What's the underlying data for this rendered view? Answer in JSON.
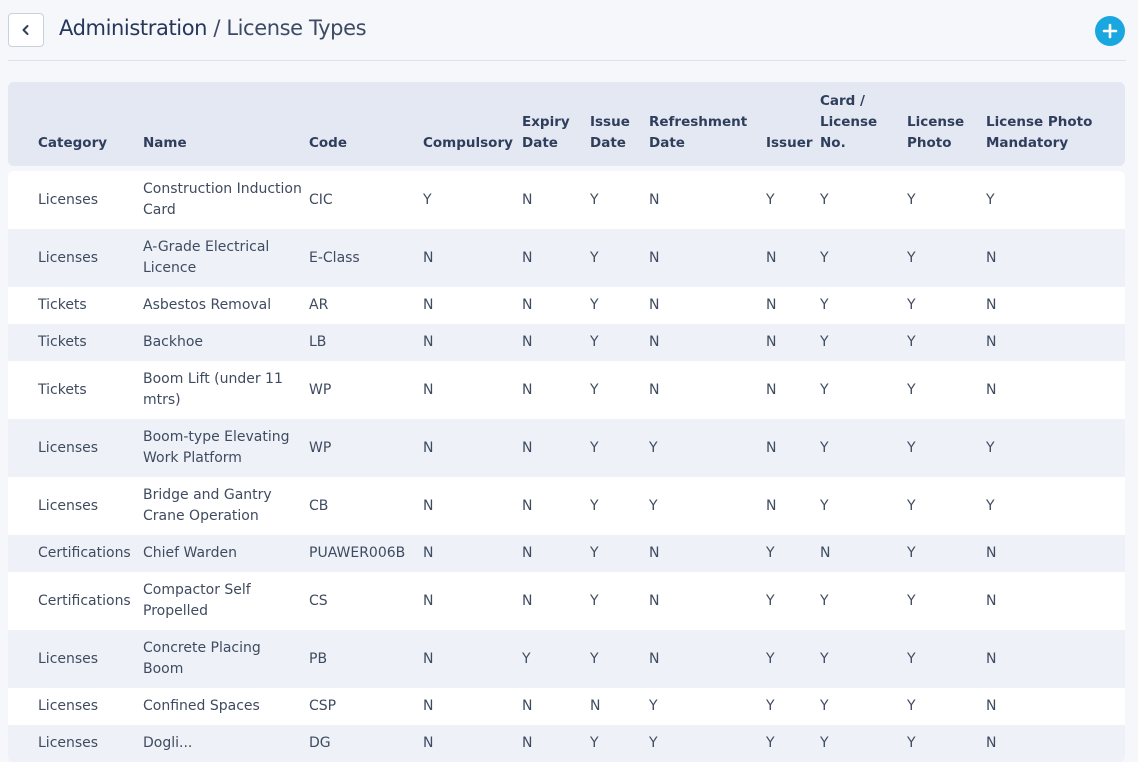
{
  "header": {
    "breadcrumb_main": "Administration",
    "breadcrumb_sep": "/",
    "breadcrumb_current": "License Types"
  },
  "icons": {
    "back": "chevron-left-icon",
    "add": "plus-circle-icon"
  },
  "colors": {
    "accent": "#1aa7e0",
    "header_bg": "#e3e8f2",
    "row_alt_bg": "#eef2f8",
    "page_bg": "#f5f7fb"
  },
  "table": {
    "columns": [
      "Category",
      "Name",
      "Code",
      "Compulsory",
      "Expiry Date",
      "Issue Date",
      "Refreshment Date",
      "Issuer",
      "Card / License No.",
      "License Photo",
      "License Photo Mandatory"
    ],
    "rows": [
      [
        "Licenses",
        "Construction Induction Card",
        "CIC",
        "Y",
        "N",
        "Y",
        "N",
        "Y",
        "Y",
        "Y",
        "Y"
      ],
      [
        "Licenses",
        "A-Grade Electrical Licence",
        "E-Class",
        "N",
        "N",
        "Y",
        "N",
        "N",
        "Y",
        "Y",
        "N"
      ],
      [
        "Tickets",
        "Asbestos Removal",
        "AR",
        "N",
        "N",
        "Y",
        "N",
        "N",
        "Y",
        "Y",
        "N"
      ],
      [
        "Tickets",
        "Backhoe",
        "LB",
        "N",
        "N",
        "Y",
        "N",
        "N",
        "Y",
        "Y",
        "N"
      ],
      [
        "Tickets",
        "Boom Lift (under 11 mtrs)",
        "WP",
        "N",
        "N",
        "Y",
        "N",
        "N",
        "Y",
        "Y",
        "N"
      ],
      [
        "Licenses",
        "Boom-type Elevating Work Platform",
        "WP",
        "N",
        "N",
        "Y",
        "Y",
        "N",
        "Y",
        "Y",
        "Y"
      ],
      [
        "Licenses",
        "Bridge and Gantry Crane Operation",
        "CB",
        "N",
        "N",
        "Y",
        "Y",
        "N",
        "Y",
        "Y",
        "Y"
      ],
      [
        "Certifications",
        "Chief Warden",
        "PUAWER006B",
        "N",
        "N",
        "Y",
        "N",
        "Y",
        "N",
        "Y",
        "N"
      ],
      [
        "Certifications",
        "Compactor Self Propelled",
        "CS",
        "N",
        "N",
        "Y",
        "N",
        "Y",
        "Y",
        "Y",
        "N"
      ],
      [
        "Licenses",
        "Concrete Placing Boom",
        "PB",
        "N",
        "Y",
        "Y",
        "N",
        "Y",
        "Y",
        "Y",
        "N"
      ],
      [
        "Licenses",
        "Confined Spaces",
        "CSP",
        "N",
        "N",
        "N",
        "Y",
        "Y",
        "Y",
        "Y",
        "N"
      ],
      [
        "Licenses",
        "Dogli...",
        "DG",
        "N",
        "N",
        "Y",
        "Y",
        "Y",
        "Y",
        "Y",
        "N"
      ]
    ]
  }
}
